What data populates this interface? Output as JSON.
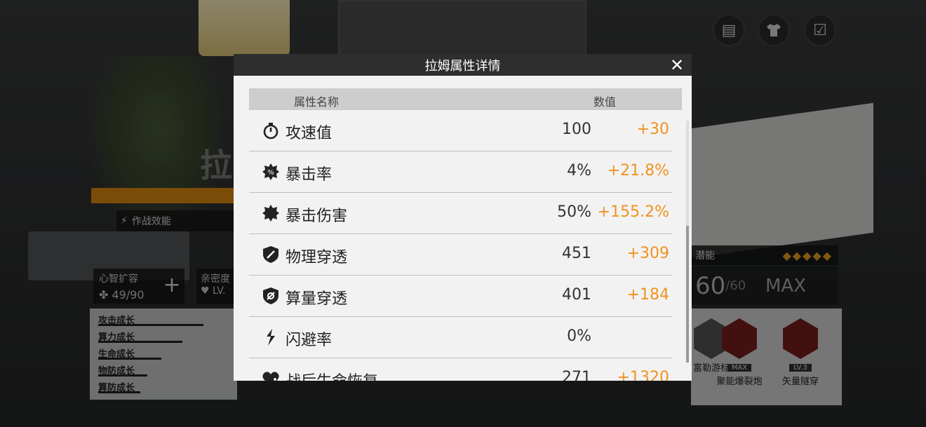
{
  "background": {
    "character_name_partial": "拉",
    "combat_eff_label": "作战效能",
    "mind_expand": {
      "title": "心智扩容",
      "value": "49/90"
    },
    "bond": {
      "title": "亲密度",
      "value": "LV."
    },
    "growth_rows": [
      "攻击成长",
      "算力成长",
      "生命成长",
      "物防成长",
      "算防成长"
    ],
    "potential_label": "潜能",
    "potential_stars": "◆◆◆◆◆",
    "level_current": "60",
    "level_max_text": "/60",
    "level_max_label": "MAX",
    "skills": [
      {
        "name": "富勒游标",
        "tag": ""
      },
      {
        "name": "聚能爆裂炮",
        "tag": "MAX"
      },
      {
        "name": "矢量隧穿",
        "tag": "LV.3"
      }
    ],
    "top_buttons": [
      {
        "name": "file-icon",
        "glyph": "▤"
      },
      {
        "name": "shirt-icon",
        "glyph": "👕"
      },
      {
        "name": "checklist-icon",
        "glyph": "☑"
      }
    ]
  },
  "dialog": {
    "title": "拉姆属性详情",
    "close_glyph": "✕",
    "header": {
      "name_col": "属性名称",
      "value_col": "数值"
    },
    "rows": [
      {
        "icon": "stopwatch",
        "label": "攻速值",
        "value": "100",
        "bonus": "+30"
      },
      {
        "icon": "crit-rate",
        "label": "暴击率",
        "value": "4%",
        "bonus": "+21.8%"
      },
      {
        "icon": "crit-damage",
        "label": "暴击伤害",
        "value": "50%",
        "bonus": "+155.2%"
      },
      {
        "icon": "physical-pierce",
        "label": "物理穿透",
        "value": "451",
        "bonus": "+309"
      },
      {
        "icon": "compute-pierce",
        "label": "算量穿透",
        "value": "401",
        "bonus": "+184"
      },
      {
        "icon": "dodge",
        "label": "闪避率",
        "value": "0%",
        "bonus": ""
      },
      {
        "icon": "heart-heal",
        "label": "战后生命恢复",
        "value": "271",
        "bonus": "+1320"
      }
    ]
  },
  "colors": {
    "accent_orange": "#f0931e",
    "header_dark": "#2e2e2e"
  }
}
